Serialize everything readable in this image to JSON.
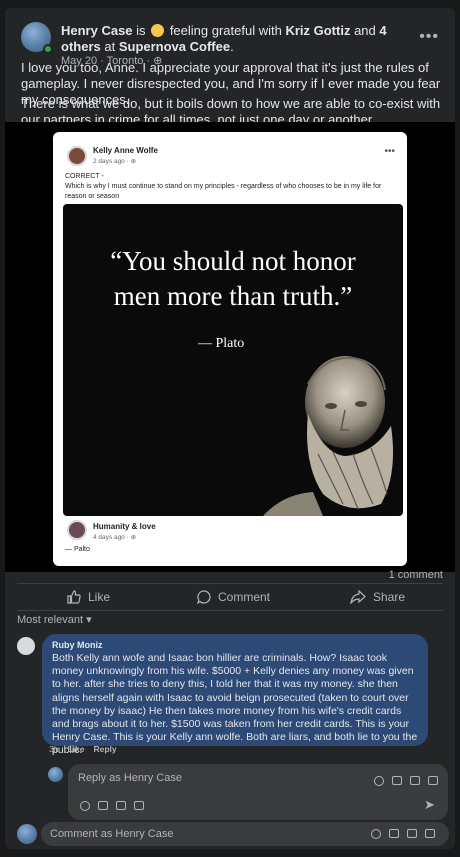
{
  "post": {
    "author": "Henry Case",
    "is_text": "is",
    "feeling_text": "feeling grateful with",
    "with_person": "Kriz Gottiz",
    "and_text": "and",
    "others": "4 others",
    "at_text": "at",
    "place": "Supernova Coffee",
    "date": "May 20",
    "location": "Toronto",
    "paragraph_1": "I love you too, Anne. I appreciate your approval that it's just the rules of gameplay. I never disrespected you, and I'm sorry if I ever made you fear my consequences.",
    "paragraph_2": "There is what we do, but it boils down to how we are able to co-exist with our partners in crime for all times, not just one day or another."
  },
  "shared": {
    "author": "Kelly Anne Wolfe",
    "time": "2 days ago",
    "line1": "CORRECT -",
    "line2": "Which is why I must continue to stand on my principles - regardless of who chooses to be in my life for reason or season",
    "quote_line1": "“You should not honor",
    "quote_line2": "men more than truth.”",
    "quote_author": "— Plato",
    "footer_author": "Humanity & love",
    "footer_time": "4 days ago",
    "footer_text": "— Palto"
  },
  "stats": {
    "comments": "1 comment"
  },
  "actions": {
    "like": "Like",
    "comment": "Comment",
    "share": "Share"
  },
  "sort": {
    "label": "Most relevant"
  },
  "comment": {
    "author": "Ruby Moniz",
    "text": "Both Kelly ann wofe and Isaac bon hillier are criminals. How? Isaac took money unknowingly from his wife. $5000 + Kelly denies any money was given to her. after she tries to deny this, I told her that it was my money. she then aligns herself again with Isaac to avoid beign prosecuted (taken to court over the money by isaac) He then takes more money from his wife's credit cards and brags about it to her. $1500 was taken from her credit cards. This is your Henry Case. This is your Kelly ann wolfe. Both are liars, and both lie to you the public.",
    "time": "3h",
    "like": "Like",
    "reply": "Reply"
  },
  "reply_box": {
    "placeholder": "Reply as Henry Case"
  },
  "comment_box": {
    "placeholder": "Comment as Henry Case"
  },
  "colors": {
    "card": "#242526",
    "bubble": "#2c4a75",
    "online": "#31a24c"
  }
}
